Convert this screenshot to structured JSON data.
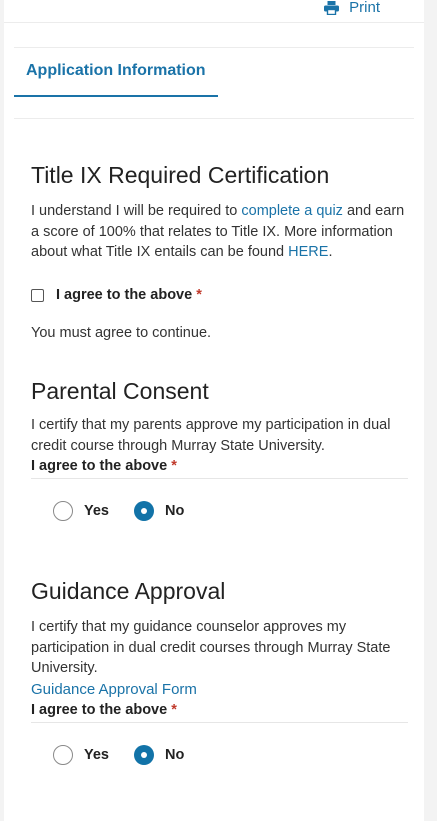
{
  "toolbar": {
    "print_label": "Print",
    "print_icon": "printer-icon"
  },
  "tabs": [
    {
      "label": "Application Information",
      "active": true
    }
  ],
  "accent_color": "#1a73a8",
  "title_ix": {
    "title": "Title IX Required Certification",
    "text_1": "I understand I will be required to ",
    "quiz_link": "complete a quiz",
    "text_2": " and earn a score of 100% that relates to Title IX. More information about what Title IX entails can be found ",
    "here_link": "HERE",
    "text_3": ".",
    "checkbox_label": "I agree to the above",
    "required_mark": "*",
    "checked": false,
    "warning": "You must agree to continue."
  },
  "parental": {
    "title": "Parental Consent",
    "text": "I certify that my parents approve my participation in dual credit course through Murray State University.",
    "agree_label": "I agree to the above",
    "required_mark": "*",
    "options": [
      {
        "label": "Yes",
        "selected": false
      },
      {
        "label": "No",
        "selected": true
      }
    ]
  },
  "guidance": {
    "title": "Guidance Approval",
    "text": "I certify that my guidance counselor approves my participation in dual credit courses through Murray State University.",
    "form_link": "Guidance Approval Form",
    "agree_label": "I agree to the above",
    "required_mark": "*",
    "options": [
      {
        "label": "Yes",
        "selected": false
      },
      {
        "label": "No",
        "selected": true
      }
    ]
  }
}
